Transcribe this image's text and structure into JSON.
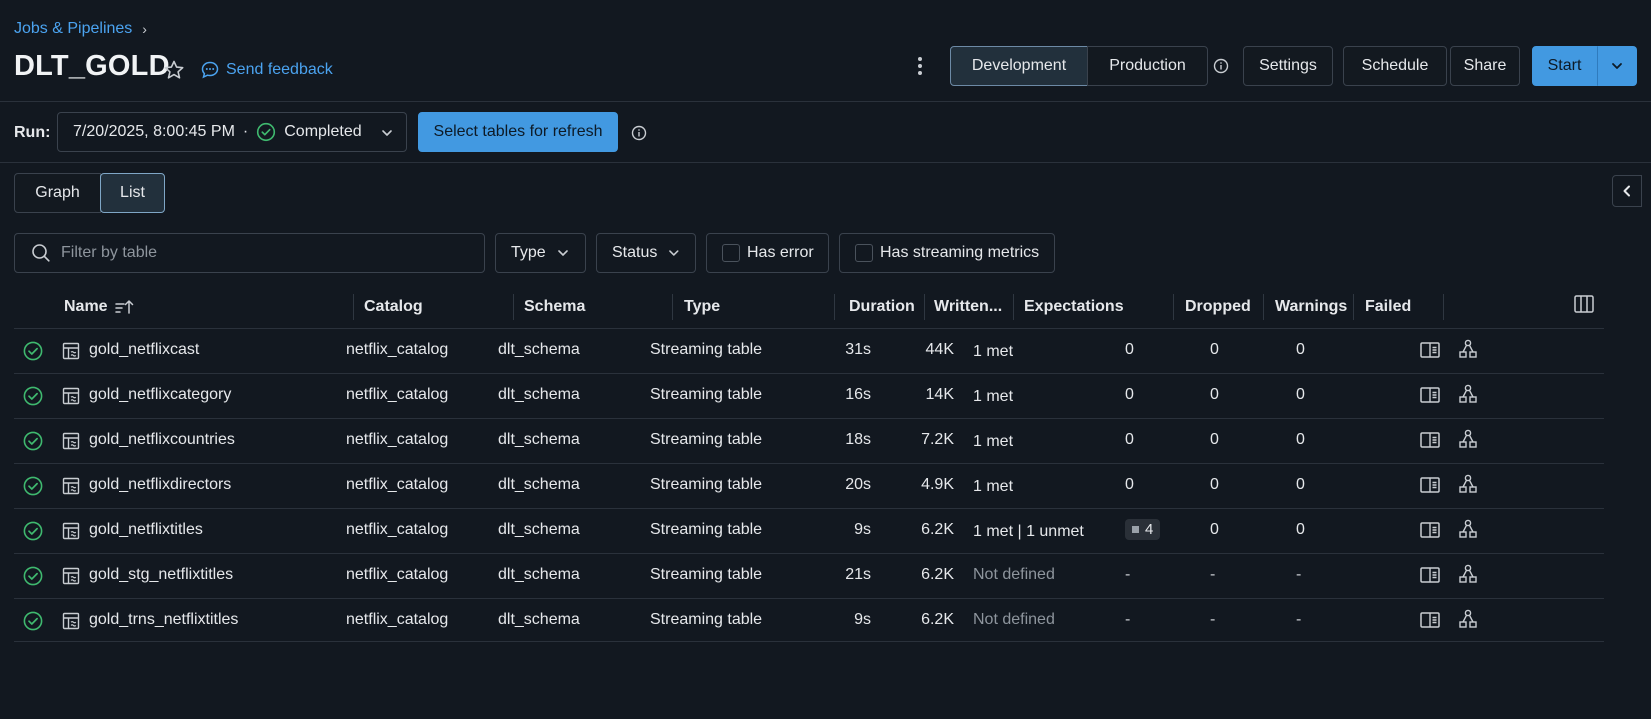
{
  "breadcrumb": {
    "parent": "Jobs & Pipelines",
    "separator": "›"
  },
  "pipeline": {
    "name": "DLT_GOLD",
    "feedback_label": "Send feedback"
  },
  "mode": {
    "development": "Development",
    "production": "Production",
    "active": "development"
  },
  "toolbar": {
    "settings": "Settings",
    "schedule": "Schedule",
    "share": "Share",
    "start": "Start"
  },
  "run": {
    "label": "Run:",
    "datetime": "7/20/2025, 8:00:45 PM",
    "dot": "·",
    "status": "Completed",
    "refresh_button": "Select tables for refresh"
  },
  "view": {
    "graph": "Graph",
    "list": "List",
    "active": "list"
  },
  "filters": {
    "search_placeholder": "Filter by table",
    "type": "Type",
    "status": "Status",
    "has_error": "Has error",
    "has_streaming_metrics": "Has streaming metrics"
  },
  "table": {
    "columns": {
      "name": "Name",
      "catalog": "Catalog",
      "schema": "Schema",
      "type": "Type",
      "duration": "Duration",
      "written": "Written...",
      "expectations": "Expectations",
      "dropped": "Dropped",
      "warnings": "Warnings",
      "failed": "Failed"
    },
    "rows": [
      {
        "name": "gold_netflixcast",
        "catalog": "netflix_catalog",
        "schema": "dlt_schema",
        "type": "Streaming table",
        "duration": "31s",
        "written": "44K",
        "expectations": "1 met",
        "dropped": "0",
        "warnings": "0",
        "failed": "0"
      },
      {
        "name": "gold_netflixcategory",
        "catalog": "netflix_catalog",
        "schema": "dlt_schema",
        "type": "Streaming table",
        "duration": "16s",
        "written": "14K",
        "expectations": "1 met",
        "dropped": "0",
        "warnings": "0",
        "failed": "0"
      },
      {
        "name": "gold_netflixcountries",
        "catalog": "netflix_catalog",
        "schema": "dlt_schema",
        "type": "Streaming table",
        "duration": "18s",
        "written": "7.2K",
        "expectations": "1 met",
        "dropped": "0",
        "warnings": "0",
        "failed": "0"
      },
      {
        "name": "gold_netflixdirectors",
        "catalog": "netflix_catalog",
        "schema": "dlt_schema",
        "type": "Streaming table",
        "duration": "20s",
        "written": "4.9K",
        "expectations": "1 met",
        "dropped": "0",
        "warnings": "0",
        "failed": "0"
      },
      {
        "name": "gold_netflixtitles",
        "catalog": "netflix_catalog",
        "schema": "dlt_schema",
        "type": "Streaming table",
        "duration": "9s",
        "written": "6.2K",
        "expectations": "1 met | 1 unmet",
        "dropped": "4",
        "warnings": "0",
        "failed": "0"
      },
      {
        "name": "gold_stg_netflixtitles",
        "catalog": "netflix_catalog",
        "schema": "dlt_schema",
        "type": "Streaming table",
        "duration": "21s",
        "written": "6.2K",
        "expectations": "Not defined",
        "dropped": "-",
        "warnings": "-",
        "failed": "-"
      },
      {
        "name": "gold_trns_netflixtitles",
        "catalog": "netflix_catalog",
        "schema": "dlt_schema",
        "type": "Streaming table",
        "duration": "9s",
        "written": "6.2K",
        "expectations": "Not defined",
        "dropped": "-",
        "warnings": "-",
        "failed": "-"
      }
    ]
  },
  "colors": {
    "accent": "#4299e1",
    "link": "#4ba3f0",
    "success": "#3fb96f",
    "background": "#121820"
  }
}
